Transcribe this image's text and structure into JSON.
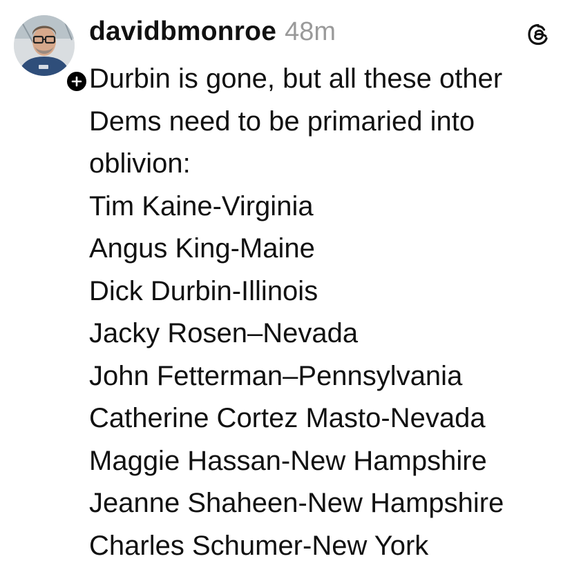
{
  "post": {
    "username": "davidbmonroe",
    "timestamp": "48m",
    "avatar_icon": "profile-photo",
    "follow_icon": "plus-icon",
    "app_icon": "threads-logo-icon",
    "intro_lines": [
      "Durbin is gone, but all these other",
      "Dems need to be primaried into",
      "oblivion:"
    ],
    "senators": [
      "Tim Kaine-Virginia",
      "Angus King-Maine",
      "Dick Durbin-Illinois",
      "Jacky Rosen–Nevada",
      "John Fetterman–Pennsylvania",
      "Catherine Cortez Masto-Nevada",
      "Maggie Hassan-New Hampshire",
      "Jeanne Shaheen-New Hampshire",
      "Charles Schumer-New York"
    ]
  }
}
